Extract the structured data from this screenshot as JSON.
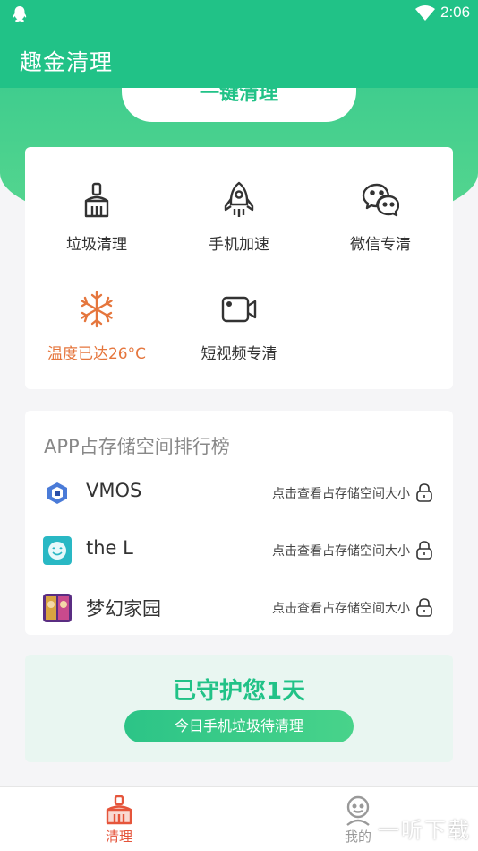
{
  "status_bar": {
    "time": "2:06",
    "left_icon": "qq-icon",
    "wifi_icon": "wifi-icon",
    "battery_icon": "battery-icon"
  },
  "app_bar": {
    "title": "趣金清理"
  },
  "clean_button": {
    "label": "一键清理"
  },
  "tools": [
    {
      "label": "垃圾清理",
      "icon": "broom-icon"
    },
    {
      "label": "手机加速",
      "icon": "rocket-icon"
    },
    {
      "label": "微信专清",
      "icon": "wechat-icon"
    },
    {
      "label": "温度已达26°C",
      "icon": "snowflake-icon",
      "color": "#e5763d"
    },
    {
      "label": "短视频专清",
      "icon": "video-camera-icon"
    }
  ],
  "ranking": {
    "title": "APP占存储空间排行榜",
    "apps": [
      {
        "name": "VMOS",
        "hint": "点击查看占存储空间大小"
      },
      {
        "name": "the L",
        "hint": "点击查看占存储空间大小"
      },
      {
        "name": "梦幻家园",
        "hint": "点击查看占存储空间大小"
      }
    ]
  },
  "guard": {
    "days_text": "已守护您1天",
    "button": "今日手机垃圾待清理"
  },
  "bottom_nav": [
    {
      "label": "清理",
      "icon": "broom-icon",
      "active": true
    },
    {
      "label": "我的",
      "icon": "profile-icon",
      "active": false
    }
  ],
  "watermark": {
    "text": "一听下载"
  },
  "colors": {
    "primary": "#21c287",
    "accent_warn": "#e5763d",
    "active_tab": "#e5553b"
  }
}
